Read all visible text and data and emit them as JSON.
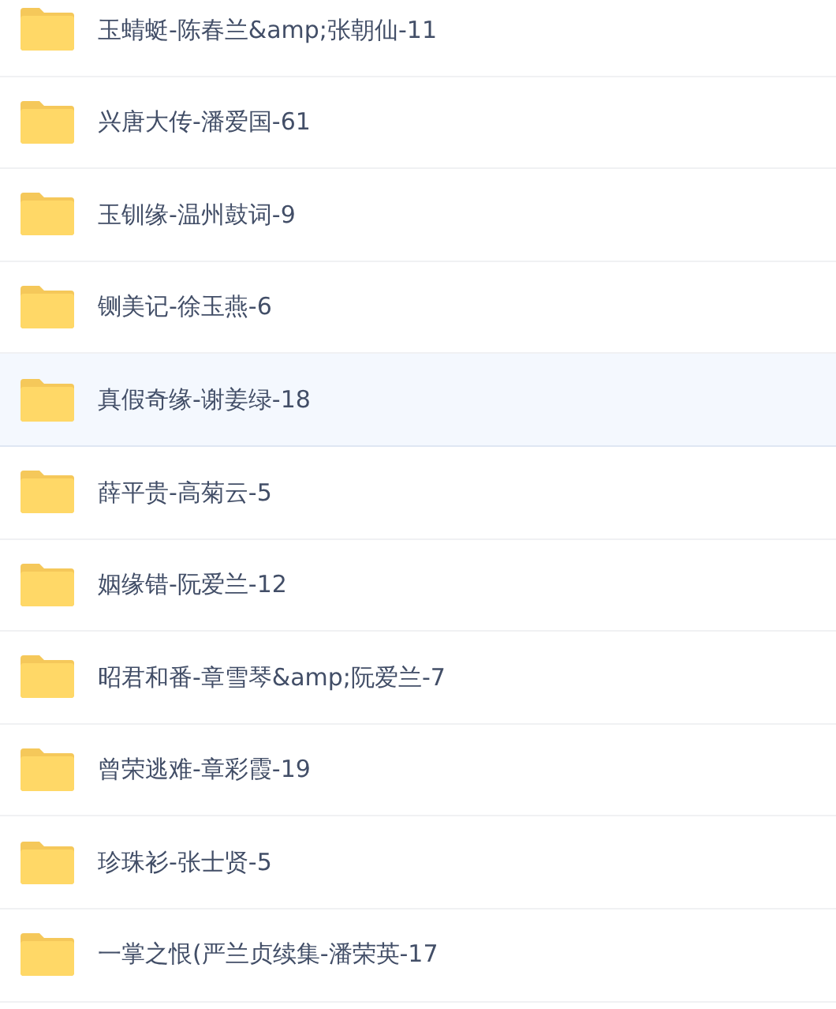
{
  "folders": [
    {
      "name": "玉蜻蜓-陈春兰&amp;张朝仙-11",
      "selected": false
    },
    {
      "name": "兴唐大传-潘爱国-61",
      "selected": false
    },
    {
      "name": "玉钏缘-温州鼓词-9",
      "selected": false
    },
    {
      "name": "铡美记-徐玉燕-6",
      "selected": false
    },
    {
      "name": "真假奇缘-谢姜绿-18",
      "selected": true
    },
    {
      "name": "薛平贵-高菊云-5",
      "selected": false
    },
    {
      "name": "姻缘错-阮爱兰-12",
      "selected": false
    },
    {
      "name": "昭君和番-章雪琴&amp;阮爱兰-7",
      "selected": false
    },
    {
      "name": "曾荣逃难-章彩霞-19",
      "selected": false
    },
    {
      "name": "珍珠衫-张士贤-5",
      "selected": false
    },
    {
      "name": "一掌之恨(严兰贞续集-潘荣英-17",
      "selected": false
    }
  ]
}
